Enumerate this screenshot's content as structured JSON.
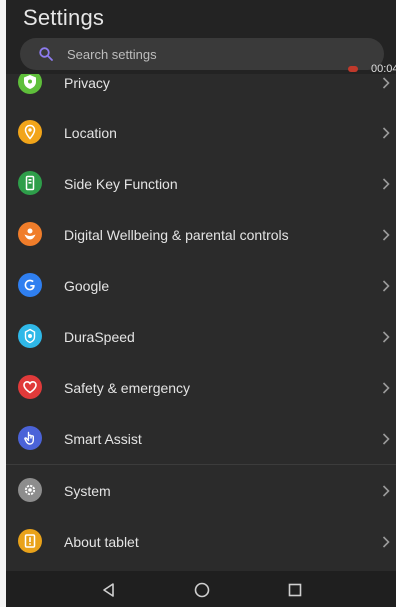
{
  "header": {
    "title": "Settings"
  },
  "search": {
    "placeholder": "Search settings"
  },
  "recording": {
    "time": "00:04"
  },
  "items": [
    {
      "label": "Privacy",
      "icon": "privacy-shield-icon",
      "color": "#5fbf3b"
    },
    {
      "label": "Location",
      "icon": "location-pin-icon",
      "color": "#f2a51a"
    },
    {
      "label": "Side Key Function",
      "icon": "side-key-icon",
      "color": "#2e9e4a"
    },
    {
      "label": "Digital Wellbeing & parental controls",
      "icon": "wellbeing-icon",
      "color": "#f07d2a"
    },
    {
      "label": "Google",
      "icon": "google-icon",
      "color": "#2f7ff0"
    },
    {
      "label": "DuraSpeed",
      "icon": "duraspeed-icon",
      "color": "#2fb8e8"
    },
    {
      "label": "Safety & emergency",
      "icon": "heart-icon",
      "color": "#e03a3a"
    },
    {
      "label": "Smart Assist",
      "icon": "hand-icon",
      "color": "#4b63d8"
    },
    {
      "label": "System",
      "icon": "system-gear-icon",
      "color": "#8d8d8d"
    },
    {
      "label": "About tablet",
      "icon": "info-icon",
      "color": "#e9a21a"
    }
  ],
  "navbar": {
    "buttons": [
      "back-icon",
      "home-icon",
      "recents-icon"
    ]
  }
}
